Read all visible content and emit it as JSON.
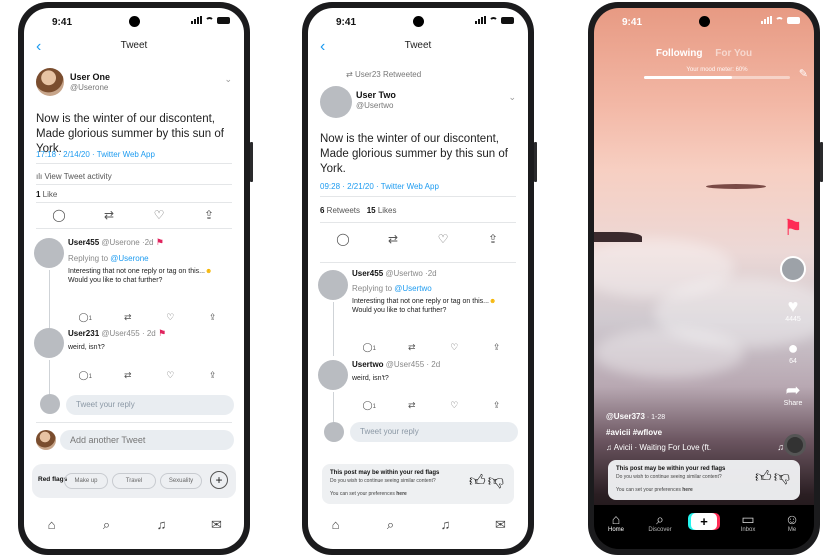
{
  "status": {
    "time": "9:41"
  },
  "phone1": {
    "nav_title": "Tweet",
    "author": {
      "name": "User One",
      "handle": "@Userone"
    },
    "text_line1": "Now is the winter of our discontent,",
    "text_line2": "Made glorious summer by this sun of York.",
    "timestamp": "17:18 · 2/14/20 · ",
    "source": "Twitter Web App",
    "activity": "View Tweet activity",
    "likes_count": "1",
    "likes_label": " Like",
    "reply1": {
      "name": "User455",
      "meta": " @Userone ·2d",
      "replying_prefix": "Replying to ",
      "replying_to": "@Userone",
      "text": "Interesting that not one reply or tag on this...",
      "text2": "Would you like to chat further?",
      "count": "1"
    },
    "reply2": {
      "name": "User231",
      "meta": " @User455 · 2d",
      "text": "weird, isn't?",
      "count": "1"
    },
    "reply_placeholder": "Tweet your reply",
    "add_placeholder": "Add another Tweet",
    "redflags": {
      "label": "Red flags",
      "chips": [
        "Make up",
        "Travel",
        "Sexuality"
      ],
      "plus": "+"
    }
  },
  "phone2": {
    "nav_title": "Tweet",
    "retweeted_by": "User23 Retweeted",
    "author": {
      "name": "User Two",
      "handle": "@Usertwo"
    },
    "text_line1": "Now is the winter of our discontent,",
    "text_line2": "Made glorious summer by this sun of York.",
    "timestamp": "09:28 · 2/21/20 · ",
    "source": "Twitter Web App",
    "retweets_count": "6",
    "retweets_label": " Retweets",
    "likes_count": "15",
    "likes_label": " Likes",
    "reply1": {
      "name": "User455",
      "meta": " @Usertwo ·2d",
      "replying_prefix": "Replying to ",
      "replying_to": "@Usertwo",
      "text": "Interesting that not one reply or tag on this...",
      "text2": "Would you like to chat further?",
      "count": "1"
    },
    "reply2": {
      "name": "Usertwo",
      "meta": " @User455 · 2d",
      "text": "weird, isn't?",
      "count": "1"
    },
    "reply_placeholder": "Tweet your reply",
    "card": {
      "title": "This post may be within your red flags",
      "question": "Do you wish to continue seeing similar content?",
      "pref_prefix": "You can set your preferences ",
      "pref_link": "here"
    }
  },
  "phone3": {
    "tab_following": "Following",
    "tab_foryou": "For You",
    "mood_label": "Your mood meter:",
    "mood_value": "60%",
    "mood_fraction": 0.6,
    "likes": "4445",
    "comments": "64",
    "share": "Share",
    "username": "@User373",
    "date": " · 1-28",
    "hashtags": "#avicii #wflove",
    "song": "Avicii · Waiting For Love (ft.",
    "card": {
      "title": "This post may be within your red flags",
      "question": "Do you wish to continue seeing similar content?",
      "pref_prefix": "You can set your preferences ",
      "pref_link": "here"
    },
    "bottom_tabs": [
      "Home",
      "Discover",
      "Inbox",
      "Me"
    ]
  },
  "colors": {
    "twitter_blue": "#1d9bf0",
    "flag_red": "#e0245e",
    "tiktok_cyan": "#25f4ee",
    "tiktok_red": "#fe2c55"
  }
}
